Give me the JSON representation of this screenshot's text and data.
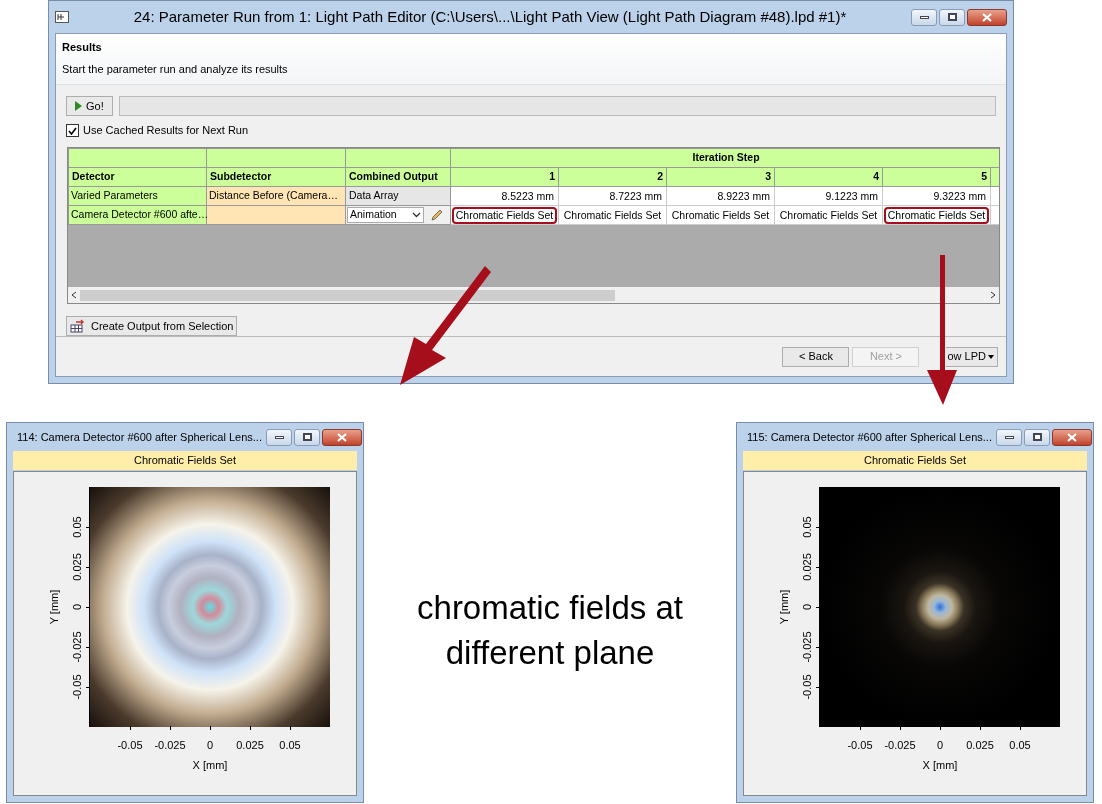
{
  "main_window": {
    "title": "24: Parameter Run from 1: Light Path Editor (C:\\Users\\...\\Light Path View (Light Path Diagram #48).lpd #1)*",
    "header": {
      "title": "Results",
      "subtitle": "Start the parameter run and analyze its results"
    },
    "go_button": "Go!",
    "progress": {
      "level": 0
    },
    "cache_checkbox": {
      "label": "Use Cached Results for Next Run",
      "checked": true
    },
    "table": {
      "group_header": "Iteration Step",
      "columns": [
        "Detector",
        "Subdetector",
        "Combined Output",
        "1",
        "2",
        "3",
        "4",
        "5"
      ],
      "rows": [
        {
          "cells": [
            {
              "kind": "label",
              "value": "Varied Parameters"
            },
            {
              "kind": "sub",
              "value": "Distance Before (Camera…"
            },
            {
              "kind": "text",
              "value": "Data Array"
            },
            {
              "kind": "number",
              "value": "8.5223 mm",
              "highlighted": false
            },
            {
              "kind": "number",
              "value": "8.7223 mm",
              "highlighted": false
            },
            {
              "kind": "number",
              "value": "8.9223 mm",
              "highlighted": false
            },
            {
              "kind": "number",
              "value": "9.1223 mm",
              "highlighted": false
            },
            {
              "kind": "number",
              "value": "9.3223 mm",
              "highlighted": false
            }
          ]
        },
        {
          "cells": [
            {
              "kind": "label",
              "value": "Camera Detector #600 afte…"
            },
            {
              "kind": "sub"
            },
            {
              "kind": "dropdown",
              "value": "Animation"
            },
            {
              "kind": "result",
              "value": "Chromatic Fields Set",
              "highlighted": true
            },
            {
              "kind": "result",
              "value": "Chromatic Fields Set",
              "highlighted": false
            },
            {
              "kind": "result",
              "value": "Chromatic Fields Set",
              "highlighted": false
            },
            {
              "kind": "result",
              "value": "Chromatic Fields Set",
              "highlighted": false
            },
            {
              "kind": "result",
              "value": "Chromatic Fields Set",
              "highlighted": true
            }
          ]
        }
      ]
    },
    "create_output_button": "Create Output from Selection",
    "nav_buttons": [
      {
        "label": "< Back",
        "disabled": false
      },
      {
        "label": "Next >",
        "disabled": true
      }
    ],
    "lpd_button": "ow LPD"
  },
  "plot_windows": [
    {
      "title": "114: Camera Detector #600 after Spherical Lens...",
      "caption": "Chromatic Fields Set",
      "xlabel": "X [mm]",
      "ylabel": "Y [mm]",
      "xticks": [
        "-0.05",
        "-0.025",
        "0",
        "0.025",
        "0.05"
      ],
      "yticks": [
        "0.05",
        "0.025",
        "0",
        "-0.025",
        "-0.05"
      ]
    },
    {
      "title": "115: Camera Detector #600 after Spherical Lens...",
      "caption": "Chromatic Fields Set",
      "xlabel": "X [mm]",
      "ylabel": "Y [mm]",
      "xticks": [
        "-0.05",
        "-0.025",
        "0",
        "0.025",
        "0.05"
      ],
      "yticks": [
        "0.05",
        "0.025",
        "0",
        "-0.025",
        "-0.05"
      ]
    }
  ],
  "annotation": "chromatic fields at different plane"
}
